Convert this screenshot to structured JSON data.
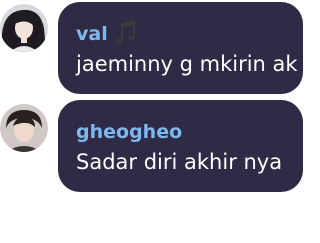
{
  "colors": {
    "bubble_bg": "#2f2a45",
    "username": "#7fb8ef",
    "message_text": "#ffffff"
  },
  "messages": [
    {
      "username": "val",
      "username_icon": "music-note-icon",
      "text": "jaeminny g mkirin ak"
    },
    {
      "username": "gheogheo",
      "text": "Sadar diri akhir nya"
    }
  ]
}
